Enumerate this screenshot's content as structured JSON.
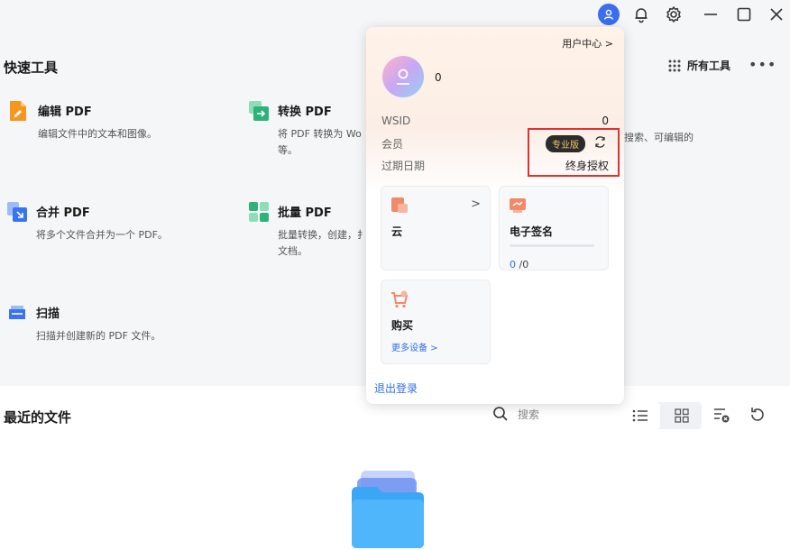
{
  "titlebar": {
    "icons": [
      "user-avatar-icon",
      "bell-icon",
      "gear-icon",
      "minimize-icon",
      "maximize-icon",
      "close-icon"
    ]
  },
  "quick_tools": {
    "title": "快速工具",
    "all_tools_label": "所有工具",
    "more_label": "•••",
    "items": [
      {
        "name": "编辑 PDF",
        "desc": "编辑文件中的文本和图像。",
        "icon": "edit-pdf-icon",
        "color": "#f5961e"
      },
      {
        "name": "转换 PDF",
        "desc": "将 PDF 转换为 Wo",
        "desc2": "等。",
        "icon": "convert-pdf-icon",
        "color": "#2fb27a"
      },
      {
        "name": "合并 PDF",
        "desc": "将多个文件合并为一个 PDF。",
        "icon": "merge-pdf-icon",
        "color": "#3a73f0"
      },
      {
        "name": "批量 PDF",
        "desc": "批量转换，创建，扌",
        "desc2": "文档。",
        "icon": "batch-pdf-icon",
        "color": "#2fb27a"
      },
      {
        "name": "扫描",
        "desc": "扫描并创建新的 PDF 文件。",
        "icon": "scan-icon",
        "color": "#3a73f0"
      }
    ],
    "partial_right_text": "搜索、可编辑的"
  },
  "recent_files": {
    "title": "最近的文件",
    "search_placeholder": "搜索"
  },
  "user_popup": {
    "user_center_label": "用户中心 >",
    "username": "0",
    "wsid_label": "WSID",
    "wsid_value": "0",
    "member_label": "会员",
    "member_badge": "专业版",
    "expire_label": "过期日期",
    "expire_value": "终身授权",
    "cloud": {
      "title": "云",
      "arrow": ">"
    },
    "esign": {
      "title": "电子签名",
      "used": "0",
      "total": " /0",
      "progress": 0
    },
    "buy": {
      "title": "购买",
      "link": "更多设备 >"
    },
    "logout_label": "退出登录"
  },
  "colors": {
    "accent": "#2f6fe8",
    "highlight_border": "#e0312f",
    "badge_bg": "#2b2b2b",
    "badge_text": "#f2c56b"
  }
}
